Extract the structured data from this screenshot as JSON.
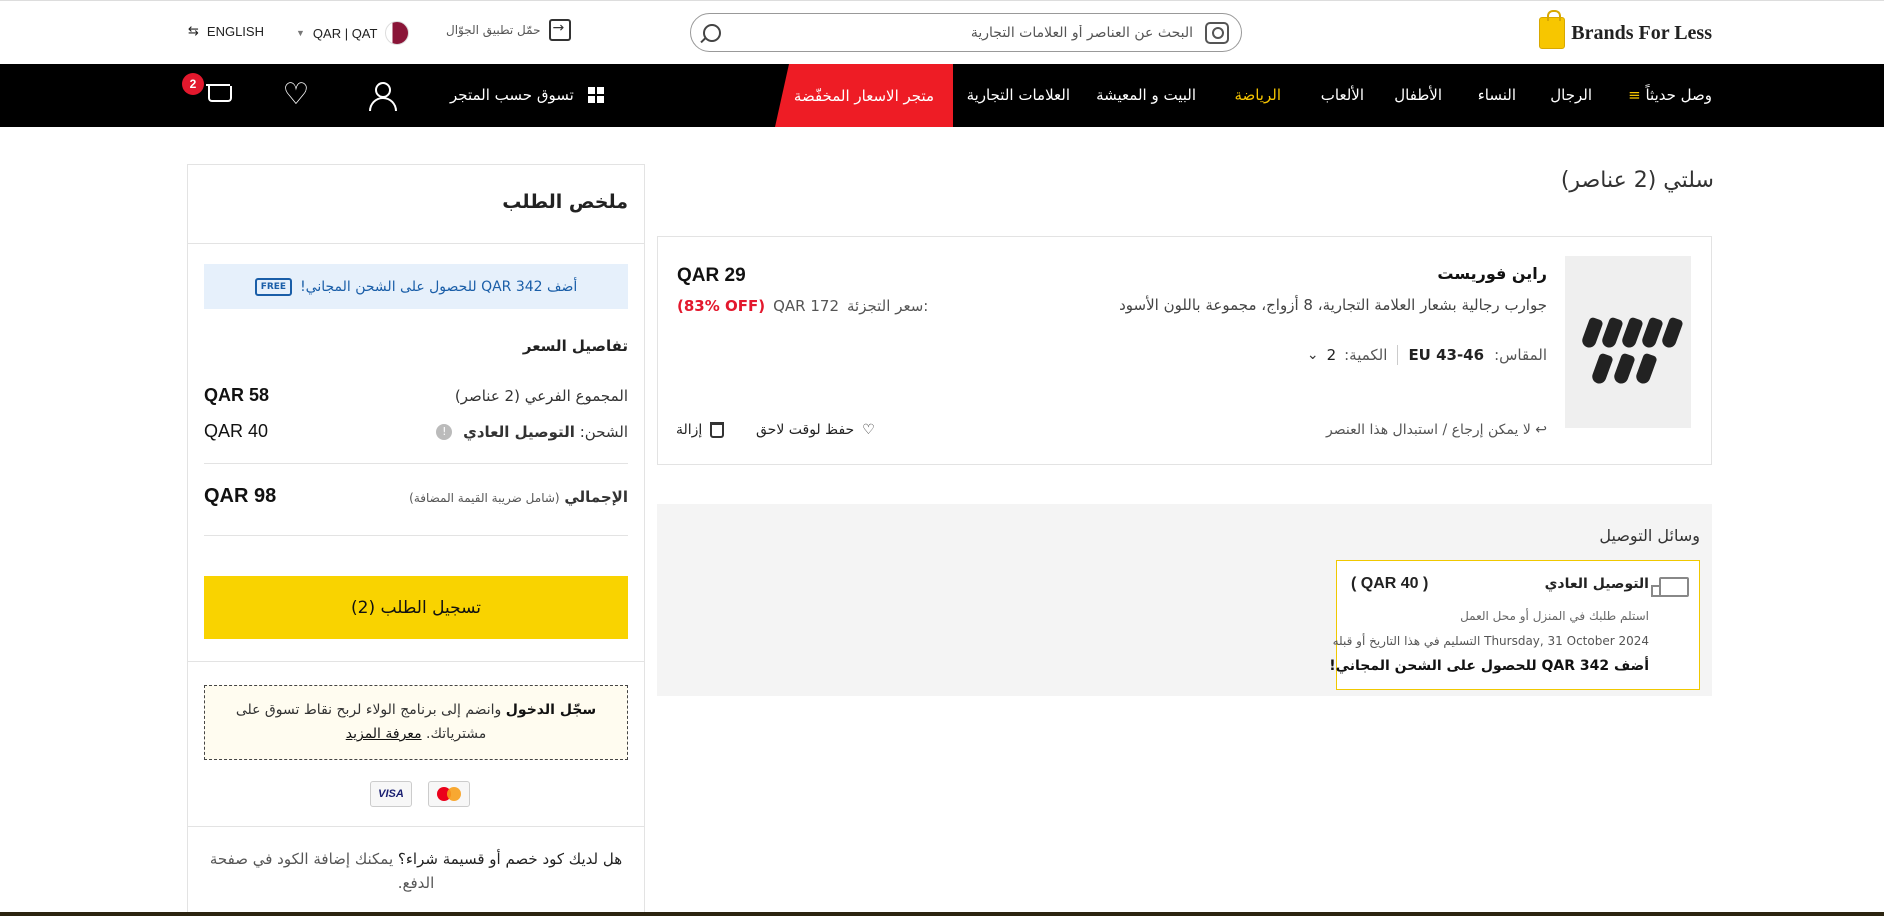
{
  "header": {
    "logo_text": "Brands For Less",
    "search_placeholder": "البحث عن العناصر أو العلامات التجارية",
    "app_link": "حمّل تطبيق الجوّال",
    "currency": "QAR | QAT",
    "language": "ENGLISH"
  },
  "nav": {
    "items": [
      "وصل حديثاً",
      "الرجال",
      "النساء",
      "الأطفال",
      "الألعاب",
      "الرياضة",
      "البيت و المعيشة",
      "العلامات التجارية"
    ],
    "sale": "متجر الاسعار المخفّضة",
    "shop_by": "تسوق حسب المتجر",
    "cart_count": "2"
  },
  "cart": {
    "title": "سلتي (2 عناصر)",
    "item": {
      "brand": "راين فوريست",
      "title": "جوارب رجالية بشعار العلامة التجارية، 8 أزواج، مجموعة باللون الأسود",
      "size_label": "المقاس:",
      "size_value": "EU 43-46",
      "qty_label": "الكمية:",
      "qty_value": "2",
      "price": "QAR 29",
      "retail_label": "سعر التجزئة:",
      "retail_price": "QAR 172",
      "discount": "(83% OFF)",
      "non_returnable": "لا يمكن إرجاع / استبدال هذا العنصر",
      "save_later": "حفظ لوقت لاحق",
      "remove": "إزالة"
    }
  },
  "delivery": {
    "title": "وسائل التوصيل",
    "option_name": "التوصيل العادي",
    "option_price": "( QAR 40 )",
    "option_note": "استلم طلبك في المنزل أو محل العمل",
    "option_date": "Thursday, 31 October 2024 التسليم في هذا التاريخ أو قبله",
    "option_free": "أضف QAR 342 للحصول على الشحن المجاني!"
  },
  "summary": {
    "title": "ملخص الطلب",
    "free_banner": "أضف QAR 342 للحصول على الشحن المجاني!",
    "free_badge": "FREE",
    "price_details": "تفاصيل السعر",
    "subtotal_label": "المجموع الفرعي (2 عناصر)",
    "subtotal_value": "QAR 58",
    "shipping_label": "الشحن:",
    "shipping_method": "التوصيل العادي",
    "shipping_value": "QAR 40",
    "total_label": "الإجمالي",
    "total_vat": "(شامل ضريبة القيمة المضافة)",
    "total_value": "QAR 98",
    "checkout": "تسجيل الطلب (2)",
    "loyalty_bold": "سجّل الدخول",
    "loyalty_text": "وانضم إلى برنامج الولاء لربح نقاط تسوق على مشترياتك.",
    "loyalty_link": "معرفة المزيد",
    "visa": "VISA",
    "promo_bold": "هل لديك كود خصم أو قسيمة شراء؟",
    "promo_text": "يمكنك إضافة الكود في صفحة الدفع."
  },
  "colors": {
    "accent_yellow": "#f9d300",
    "sale_red": "#ee1c25",
    "nav_black": "#000000",
    "banner_blue": "#1a5ea8"
  }
}
